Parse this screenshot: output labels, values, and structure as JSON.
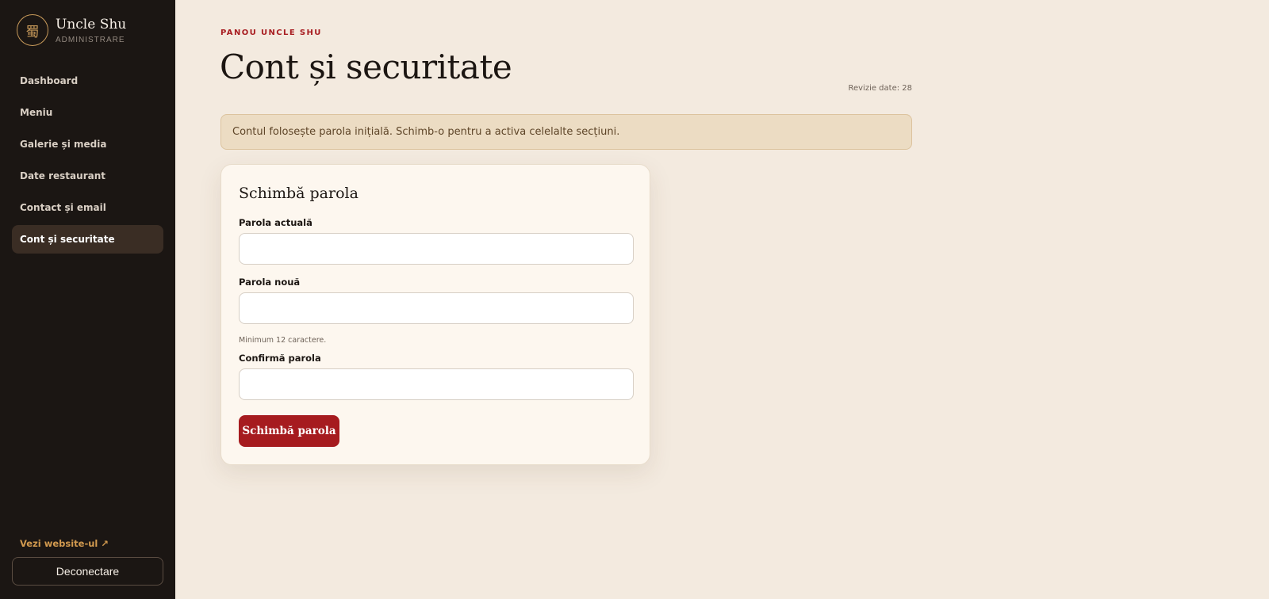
{
  "sidebar": {
    "brand_name": "Uncle Shu",
    "brand_sub": "ADMINISTRARE",
    "logo_glyph": "蜀",
    "items": [
      {
        "label": "Dashboard",
        "active": false
      },
      {
        "label": "Meniu",
        "active": false
      },
      {
        "label": "Galerie și media",
        "active": false
      },
      {
        "label": "Date restaurant",
        "active": false
      },
      {
        "label": "Contact și email",
        "active": false
      },
      {
        "label": "Cont și securitate",
        "active": true
      }
    ],
    "visit_link": "Vezi website-ul ↗",
    "logout_label": "Deconectare"
  },
  "header": {
    "eyebrow": "PANOU UNCLE SHU",
    "title": "Cont și securitate",
    "revision": "Revizie date: 28"
  },
  "alert": {
    "text": "Contul folosește parola inițială. Schimb-o pentru a activa celelalte secțiuni."
  },
  "form": {
    "title": "Schimbă parola",
    "current_label": "Parola actuală",
    "current_value": "",
    "new_label": "Parola nouă",
    "new_value": "",
    "new_hint": "Minimum 12 caractere.",
    "confirm_label": "Confirmă parola",
    "confirm_value": "",
    "submit_label": "Schimbă parola"
  },
  "colors": {
    "sidebar_bg": "#1b1613",
    "page_bg": "#f3eadf",
    "accent": "#a61b1f",
    "brand_gold": "#c89a5a"
  }
}
